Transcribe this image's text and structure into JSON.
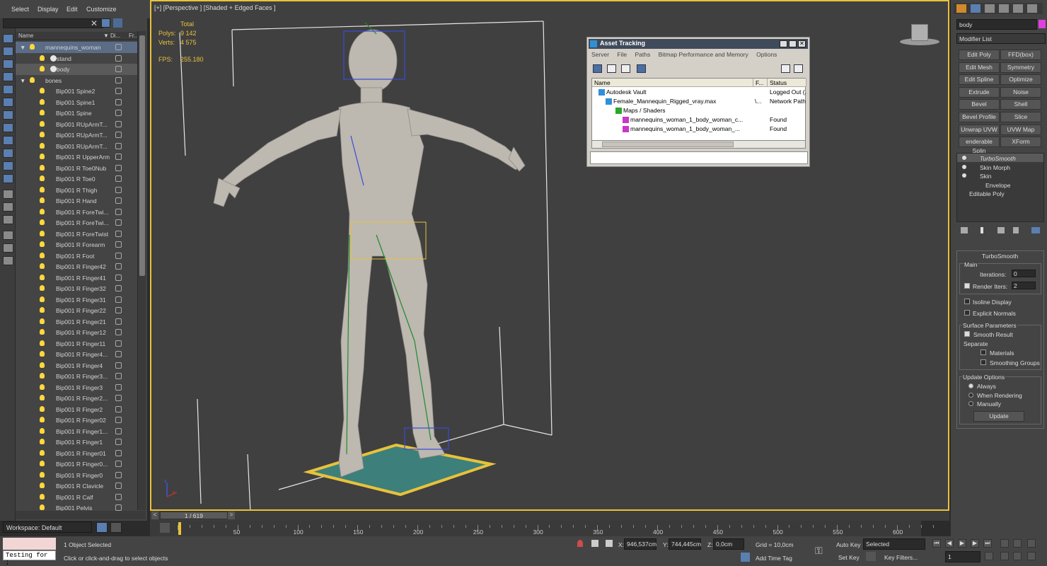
{
  "menu": [
    "Select",
    "Display",
    "Edit",
    "Customize"
  ],
  "explorer": {
    "col_name": "Name",
    "col_display": "Di...",
    "col_freeze": "Fr...",
    "rows": [
      {
        "label": "mannequins_woman",
        "indent": 1,
        "type": "layer",
        "state": "selected"
      },
      {
        "label": "stand",
        "indent": 2,
        "type": "object",
        "state": ""
      },
      {
        "label": "body",
        "indent": 2,
        "type": "object",
        "state": "highlight"
      },
      {
        "label": "bones",
        "indent": 1,
        "type": "layer",
        "state": ""
      },
      {
        "label": "Bip001 Spine2",
        "indent": 2,
        "type": "bone",
        "state": ""
      },
      {
        "label": "Bip001 Spine1",
        "indent": 2,
        "type": "bone",
        "state": ""
      },
      {
        "label": "Bip001 Spine",
        "indent": 2,
        "type": "bone",
        "state": ""
      },
      {
        "label": "Bip001 RUpArmT...",
        "indent": 2,
        "type": "bone",
        "state": ""
      },
      {
        "label": "Bip001 RUpArmT...",
        "indent": 2,
        "type": "bone",
        "state": ""
      },
      {
        "label": "Bip001 RUpArmT...",
        "indent": 2,
        "type": "bone",
        "state": ""
      },
      {
        "label": "Bip001 R UpperArm",
        "indent": 2,
        "type": "bone",
        "state": ""
      },
      {
        "label": "Bip001 R Toe0Nub",
        "indent": 2,
        "type": "bone",
        "state": ""
      },
      {
        "label": "Bip001 R Toe0",
        "indent": 2,
        "type": "bone",
        "state": ""
      },
      {
        "label": "Bip001 R Thigh",
        "indent": 2,
        "type": "bone",
        "state": ""
      },
      {
        "label": "Bip001 R Hand",
        "indent": 2,
        "type": "bone",
        "state": ""
      },
      {
        "label": "Bip001 R ForeTwi...",
        "indent": 2,
        "type": "bone",
        "state": ""
      },
      {
        "label": "Bip001 R ForeTwi...",
        "indent": 2,
        "type": "bone",
        "state": ""
      },
      {
        "label": "Bip001 R ForeTwist",
        "indent": 2,
        "type": "bone",
        "state": ""
      },
      {
        "label": "Bip001 R Forearm",
        "indent": 2,
        "type": "bone",
        "state": ""
      },
      {
        "label": "Bip001 R Foot",
        "indent": 2,
        "type": "bone",
        "state": ""
      },
      {
        "label": "Bip001 R Finger42",
        "indent": 2,
        "type": "bone",
        "state": ""
      },
      {
        "label": "Bip001 R Finger41",
        "indent": 2,
        "type": "bone",
        "state": ""
      },
      {
        "label": "Bip001 R Finger32",
        "indent": 2,
        "type": "bone",
        "state": ""
      },
      {
        "label": "Bip001 R Finger31",
        "indent": 2,
        "type": "bone",
        "state": ""
      },
      {
        "label": "Bip001 R Finger22",
        "indent": 2,
        "type": "bone",
        "state": ""
      },
      {
        "label": "Bip001 R Finger21",
        "indent": 2,
        "type": "bone",
        "state": ""
      },
      {
        "label": "Bip001 R Finger12",
        "indent": 2,
        "type": "bone",
        "state": ""
      },
      {
        "label": "Bip001 R Finger11",
        "indent": 2,
        "type": "bone",
        "state": ""
      },
      {
        "label": "Bip001 R Finger4...",
        "indent": 2,
        "type": "bone",
        "state": ""
      },
      {
        "label": "Bip001 R Finger4",
        "indent": 2,
        "type": "bone",
        "state": ""
      },
      {
        "label": "Bip001 R Finger3...",
        "indent": 2,
        "type": "bone",
        "state": ""
      },
      {
        "label": "Bip001 R Finger3",
        "indent": 2,
        "type": "bone",
        "state": ""
      },
      {
        "label": "Bip001 R Finger2...",
        "indent": 2,
        "type": "bone",
        "state": ""
      },
      {
        "label": "Bip001 R Finger2",
        "indent": 2,
        "type": "bone",
        "state": ""
      },
      {
        "label": "Bip001 R Finger02",
        "indent": 2,
        "type": "bone",
        "state": ""
      },
      {
        "label": "Bip001 R Finger1...",
        "indent": 2,
        "type": "bone",
        "state": ""
      },
      {
        "label": "Bip001 R Finger1",
        "indent": 2,
        "type": "bone",
        "state": ""
      },
      {
        "label": "Bip001 R Finger01",
        "indent": 2,
        "type": "bone",
        "state": ""
      },
      {
        "label": "Bip001 R Finger0...",
        "indent": 2,
        "type": "bone",
        "state": ""
      },
      {
        "label": "Bip001 R Finger0",
        "indent": 2,
        "type": "bone",
        "state": ""
      },
      {
        "label": "Bip001 R Clavicle",
        "indent": 2,
        "type": "bone",
        "state": ""
      },
      {
        "label": "Bip001 R Calf",
        "indent": 2,
        "type": "bone",
        "state": ""
      },
      {
        "label": "Bip001 Pelvis",
        "indent": 2,
        "type": "bone",
        "state": ""
      }
    ]
  },
  "workspace": "Workspace: Default",
  "viewport": {
    "label": "[+] [Perspective ] [Shaded + Edged Faces ]",
    "total_label": "Total",
    "polys_label": "Polys:",
    "polys_value": "9 142",
    "verts_label": "Verts:",
    "verts_value": "4 575",
    "fps_label": "FPS:",
    "fps_value": "255.180",
    "accent": "#e8c23a"
  },
  "asset_tracking": {
    "title": "Asset Tracking",
    "menu": [
      "Server",
      "File",
      "Paths",
      "Bitmap Performance and Memory",
      "Options"
    ],
    "col_name": "Name",
    "col_f": "F...",
    "col_status": "Status",
    "rows": [
      {
        "name": "Autodesk Vault",
        "f": "",
        "status": "Logged Out (..."
      },
      {
        "name": "Female_Mannequin_Rigged_vray.max",
        "f": "\\...",
        "status": "Network Path"
      },
      {
        "name": "Maps / Shaders",
        "f": "",
        "status": ""
      },
      {
        "name": "mannequins_woman_1_body_woman_c...",
        "f": "",
        "status": "Found"
      },
      {
        "name": "mannequins_woman_1_body_woman_...",
        "f": "",
        "status": "Found"
      }
    ]
  },
  "command_panel": {
    "object_name": "body",
    "modifier_list": "Modifier List",
    "buttons": [
      "Edit Poly",
      "FFD(box)",
      "Edit Mesh",
      "Symmetry",
      "Edit Spline",
      "Optimize",
      "Extrude",
      "Noise",
      "Bevel",
      "Shell",
      "Bevel Profile",
      "Slice",
      "Unwrap UVW",
      "UVW Map",
      "enderable Splin",
      "XForm"
    ],
    "stack": [
      "TurboSmooth",
      "Skin Morph",
      "Skin",
      "Envelope",
      "Editable Poly"
    ],
    "rollout_title": "TurboSmooth",
    "main_label": "Main",
    "iterations_label": "Iterations:",
    "iterations_value": "0",
    "render_iters_label": "Render Iters:",
    "render_iters_value": "2",
    "isoline": "Isoline Display",
    "explicit": "Explicit Normals",
    "surface_params": "Surface Parameters",
    "smooth_result": "Smooth Result",
    "separate": "Separate",
    "materials": "Materials",
    "smoothing_groups": "Smoothing Groups",
    "update_options": "Update Options",
    "always": "Always",
    "when_rendering": "When Rendering",
    "manually": "Manually",
    "update_btn": "Update"
  },
  "timeline": {
    "frame": "1 / 619",
    "ticks": [
      "50",
      "100",
      "150",
      "200",
      "250",
      "300",
      "350",
      "400",
      "450",
      "500",
      "550",
      "600"
    ]
  },
  "status": {
    "script": "Testing for ;",
    "selected": "1 Object Selected",
    "prompt": "Click or click-and-drag to select objects",
    "x_label": "X:",
    "x_value": "946,537cm",
    "y_label": "Y:",
    "y_value": "744,445cm",
    "z_label": "Z:",
    "z_value": "0,0cm",
    "grid": "Grid = 10,0cm",
    "add_time_tag": "Add Time Tag",
    "auto_key": "Auto Key",
    "set_key": "Set Key",
    "selected_dd": "Selected",
    "key_filters": "Key Filters...",
    "frame_input": "1"
  }
}
